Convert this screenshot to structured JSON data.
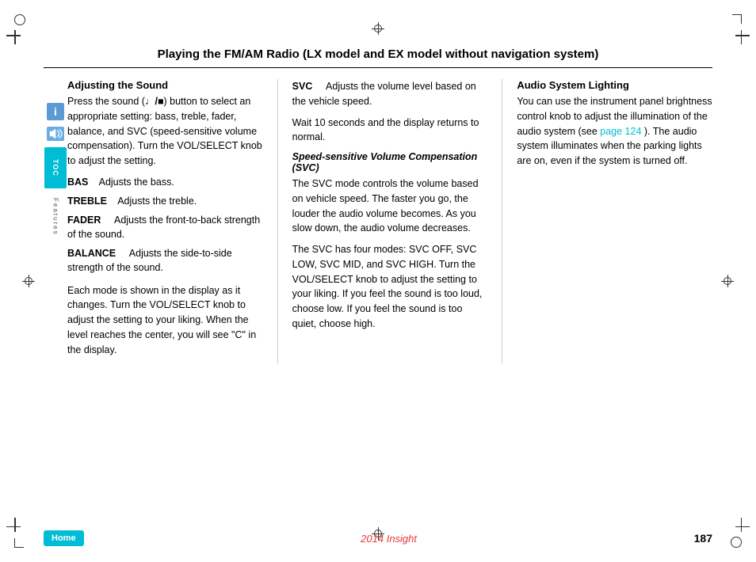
{
  "page": {
    "title": "Playing the FM/AM Radio (LX model and EX model without navigation system)",
    "footer_title": "2014 Insight",
    "page_number": "187",
    "home_label": "Home"
  },
  "left_column": {
    "section_heading": "Adjusting the Sound",
    "intro_text": "Press the sound (♪/■) button to select an appropriate setting: bass, treble, fader, balance, and SVC (speed-sensitive volume compensation). Turn the VOL/SELECT knob to adjust the setting.",
    "terms": [
      {
        "term": "BAS",
        "definition": "Adjusts the bass."
      },
      {
        "term": "TREBLE",
        "definition": "Adjusts the treble."
      },
      {
        "term": "FADER",
        "definition": "Adjusts the front-to-back strength of the sound."
      },
      {
        "term": "BALANCE",
        "definition": "Adjusts the side-to-side strength of the sound."
      }
    ],
    "mode_text": "Each mode is shown in the display as it changes. Turn the VOL/SELECT knob to adjust the setting to your liking. When the level reaches the center, you will see “C” in the display."
  },
  "middle_column": {
    "svc_term": "SVC",
    "svc_def": "Adjusts the volume level based on the vehicle speed.",
    "wait_text": "Wait 10 seconds and the display returns to normal.",
    "italic_heading": "Speed-sensitive Volume Compensation (SVC)",
    "svc_body": "The SVC mode controls the volume based on vehicle speed. The faster you go, the louder the audio volume becomes. As you slow down, the audio volume decreases.",
    "svc_modes_text": "The SVC has four modes: SVC OFF, SVC LOW, SVC MID, and SVC HIGH. Turn the VOL/SELECT knob to adjust the setting to your liking. If you feel the sound is too loud, choose low. If you feel the sound is too quiet, choose high."
  },
  "right_column": {
    "heading": "Audio System Lighting",
    "body": "You can use the instrument panel brightness control knob to adjust the illumination of the audio system (see",
    "link_text": "page 124",
    "body2": "). The audio system illuminates when the parking lights are on, even if the system is turned off."
  },
  "icons": {
    "info_label": "i",
    "toc_label": "TOC",
    "features_label": "Features"
  }
}
